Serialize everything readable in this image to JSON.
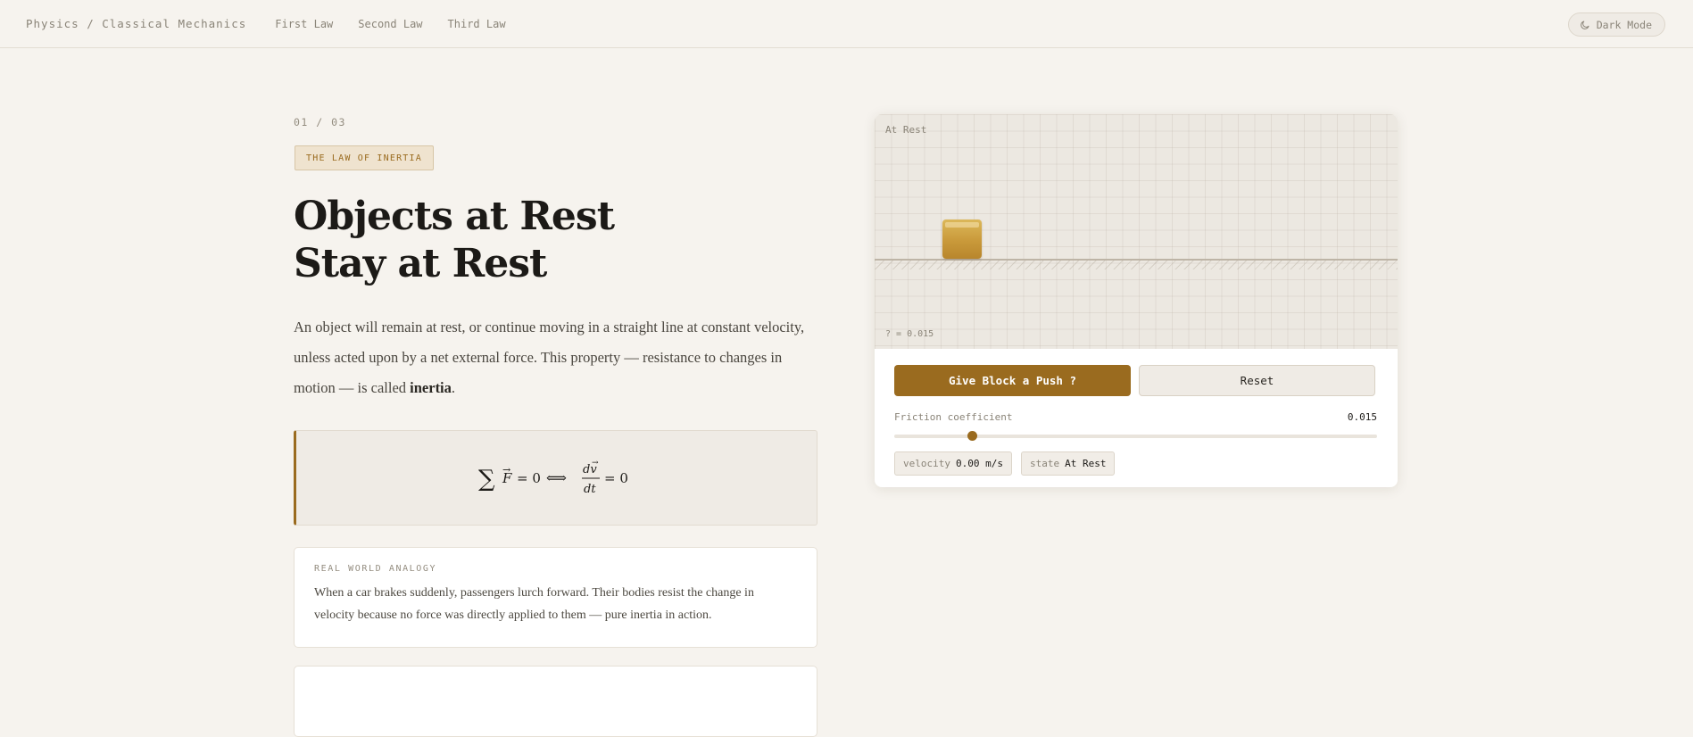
{
  "nav": {
    "breadcrumb": "Physics / Classical Mechanics",
    "links": [
      "First Law",
      "Second Law",
      "Third Law"
    ],
    "dark_mode_label": "Dark Mode",
    "dark_mode_icon": "moon-icon"
  },
  "lesson": {
    "step": "01 / 03",
    "tag": "THE LAW OF INERTIA",
    "title_line1": "Objects at Rest",
    "title_line2": "Stay at Rest",
    "intro_text": "An object will remain at rest, or continue moving in a straight line at constant velocity, unless acted upon by a net external force. This property — resistance to changes in motion — is called ",
    "intro_emphasis": "inertia",
    "intro_end": ".",
    "formula": "∑F⃗ = 0 ⟺ dv⃗/dt = 0",
    "analogy": {
      "label": "REAL WORLD ANALOGY",
      "text": "When a car brakes suddenly, passengers lurch forward. Their bodies resist the change in velocity because no force was directly applied to them — pure inertia in action."
    }
  },
  "simulation": {
    "state_label": "At Rest",
    "mu_label": "? = 0.015",
    "block_position": 0.14,
    "push_button": "Give Block a Push ?",
    "reset_button": "Reset",
    "friction_label": "Friction coefficient",
    "friction_value": "0.015",
    "friction_fraction": 0.16,
    "readouts": {
      "velocity_key": "velocity",
      "velocity_value": "0.00 m/s",
      "state_key": "state",
      "state_value": "At Rest"
    }
  },
  "colors": {
    "accent": "#9a6b1f",
    "background": "#f6f3ee",
    "block": "#c9993a"
  }
}
